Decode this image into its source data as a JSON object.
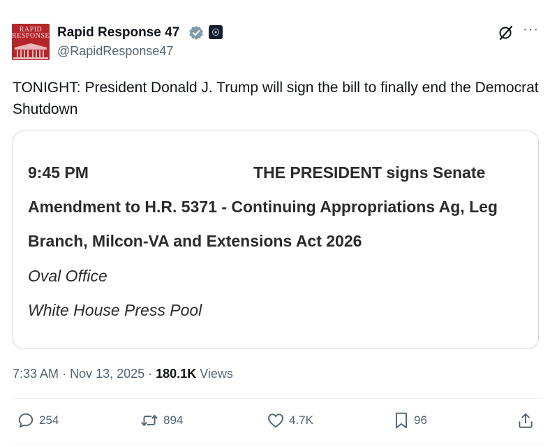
{
  "author": {
    "avatar_text_line1": "RAPID",
    "avatar_text_line2": "RESPONSE",
    "display_name": "Rapid Response 47",
    "handle": "@RapidResponse47",
    "verified_icon": "verified-badge-icon",
    "affiliation_icon": "affiliation-badge-icon"
  },
  "header_actions": {
    "grok_icon": "grok-icon",
    "more_label": "···"
  },
  "tweet": {
    "text": "TONIGHT: President Donald J. Trump will sign the bill to finally end the Democrat Shutdown"
  },
  "card": {
    "time": "9:45 PM",
    "line1": "THE PRESIDENT signs Senate",
    "line2": "Amendment to H.R. 5371 - Continuing Appropriations Ag, Leg",
    "line3": "Branch, Milcon-VA and Extensions Act 2026",
    "location": "Oval Office",
    "pool": "White House Press Pool"
  },
  "meta": {
    "time": "7:33 AM",
    "date": "Nov 13, 2025",
    "views_count": "180.1K",
    "views_label": "Views"
  },
  "actions": {
    "replies": "254",
    "reposts": "894",
    "likes": "4.7K",
    "bookmarks": "96"
  },
  "colors": {
    "text": "#0f1419",
    "secondary": "#536471",
    "verified": "#829aab",
    "border": "#cfd9de",
    "avatar": "#b3262b"
  }
}
